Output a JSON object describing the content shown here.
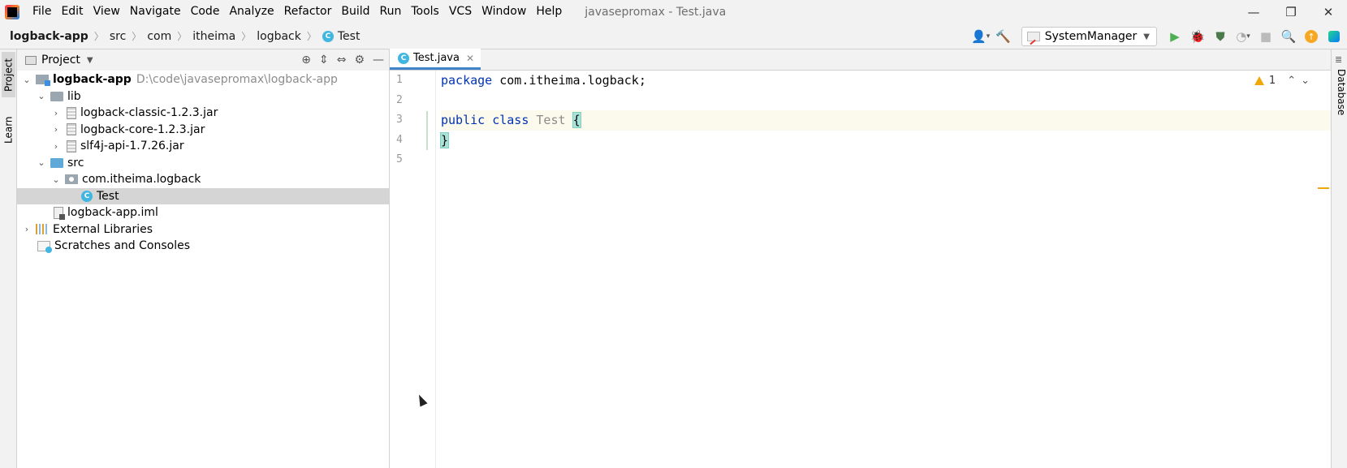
{
  "menubar": {
    "items": [
      "File",
      "Edit",
      "View",
      "Navigate",
      "Code",
      "Analyze",
      "Refactor",
      "Build",
      "Run",
      "Tools",
      "VCS",
      "Window",
      "Help"
    ],
    "window_title": "javasepromax - Test.java"
  },
  "window_controls": {
    "minimize": "—",
    "restore": "❐",
    "close": "✕"
  },
  "breadcrumb": [
    "logback-app",
    "src",
    "com",
    "itheima",
    "logback",
    "Test"
  ],
  "toolbar": {
    "run_config": "SystemManager"
  },
  "side_tabs": {
    "project": "Project",
    "learn": "Learn",
    "database": "Database"
  },
  "project_panel": {
    "title": "Project",
    "tree": [
      {
        "label": "logback-app",
        "hint": "D:\\code\\javasepromax\\logback-app",
        "level": 0,
        "icon": "module-icon",
        "expanded": true
      },
      {
        "label": "lib",
        "level": 1,
        "icon": "folder-icon",
        "expanded": true
      },
      {
        "label": "logback-classic-1.2.3.jar",
        "level": 2,
        "icon": "jar-icon",
        "expanded": false
      },
      {
        "label": "logback-core-1.2.3.jar",
        "level": 2,
        "icon": "jar-icon",
        "expanded": false
      },
      {
        "label": "slf4j-api-1.7.26.jar",
        "level": 2,
        "icon": "jar-icon",
        "expanded": false
      },
      {
        "label": "src",
        "level": 1,
        "icon": "source-folder-icon",
        "expanded": true
      },
      {
        "label": "com.itheima.logback",
        "level": 2,
        "icon": "package-icon",
        "expanded": true
      },
      {
        "label": "Test",
        "level": 3,
        "icon": "class-icon",
        "selected": true
      },
      {
        "label": "logback-app.iml",
        "level": 1,
        "icon": "iml-file-icon"
      },
      {
        "label": "External Libraries",
        "level": 0,
        "icon": "libraries-icon",
        "expanded": false
      },
      {
        "label": "Scratches and Consoles",
        "level": 0,
        "icon": "scratches-icon"
      }
    ]
  },
  "editor": {
    "tab_label": "Test.java",
    "line_numbers": [
      "1",
      "2",
      "3",
      "4",
      "5"
    ],
    "code": {
      "l1_kw": "package",
      "l1_rest": " com.itheima.logback;",
      "l3_kw1": "public",
      "l3_kw2": "class",
      "l3_name": "Test",
      "l3_brace": "{",
      "l4_brace": "}"
    },
    "inspection": {
      "warnings": "1"
    }
  }
}
